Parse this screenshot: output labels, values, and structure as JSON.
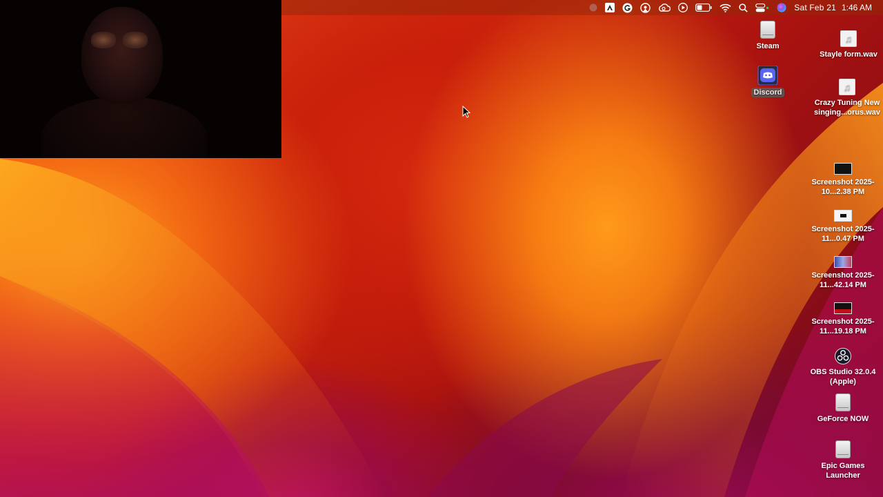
{
  "menubar": {
    "date": "Sat Feb 21",
    "time": "1:46 AM",
    "tray_icons": [
      "record-icon",
      "adobe-icon",
      "grammarly-icon",
      "airplay-icon",
      "creative-cloud-icon",
      "play-icon",
      "battery-icon",
      "wifi-icon",
      "search-icon",
      "control-center-icon",
      "siri-icon"
    ]
  },
  "desktop": {
    "icons": [
      {
        "label": "Steam",
        "type": "drive"
      },
      {
        "label": "Discord",
        "type": "app"
      },
      {
        "label": "Stayle form.wav",
        "type": "audio"
      },
      {
        "label": "Crazy Tuning New singing...orus.wav",
        "type": "audio"
      },
      {
        "label": "Screenshot 2025-10...2.38 PM",
        "type": "image"
      },
      {
        "label": "Screenshot 2025-11...0.47 PM",
        "type": "image"
      },
      {
        "label": "Screenshot 2025-11...42.14 PM",
        "type": "image"
      },
      {
        "label": "Screenshot 2025-11...19.18 PM",
        "type": "image"
      },
      {
        "label": "OBS Studio 32.0.4 (Apple)",
        "type": "app"
      },
      {
        "label": "GeForce NOW",
        "type": "drive"
      },
      {
        "label": "Epic Games Launcher",
        "type": "drive"
      }
    ]
  },
  "colors": {
    "discord_brand": "#5865F2",
    "menubar_bg": "#96280a"
  }
}
